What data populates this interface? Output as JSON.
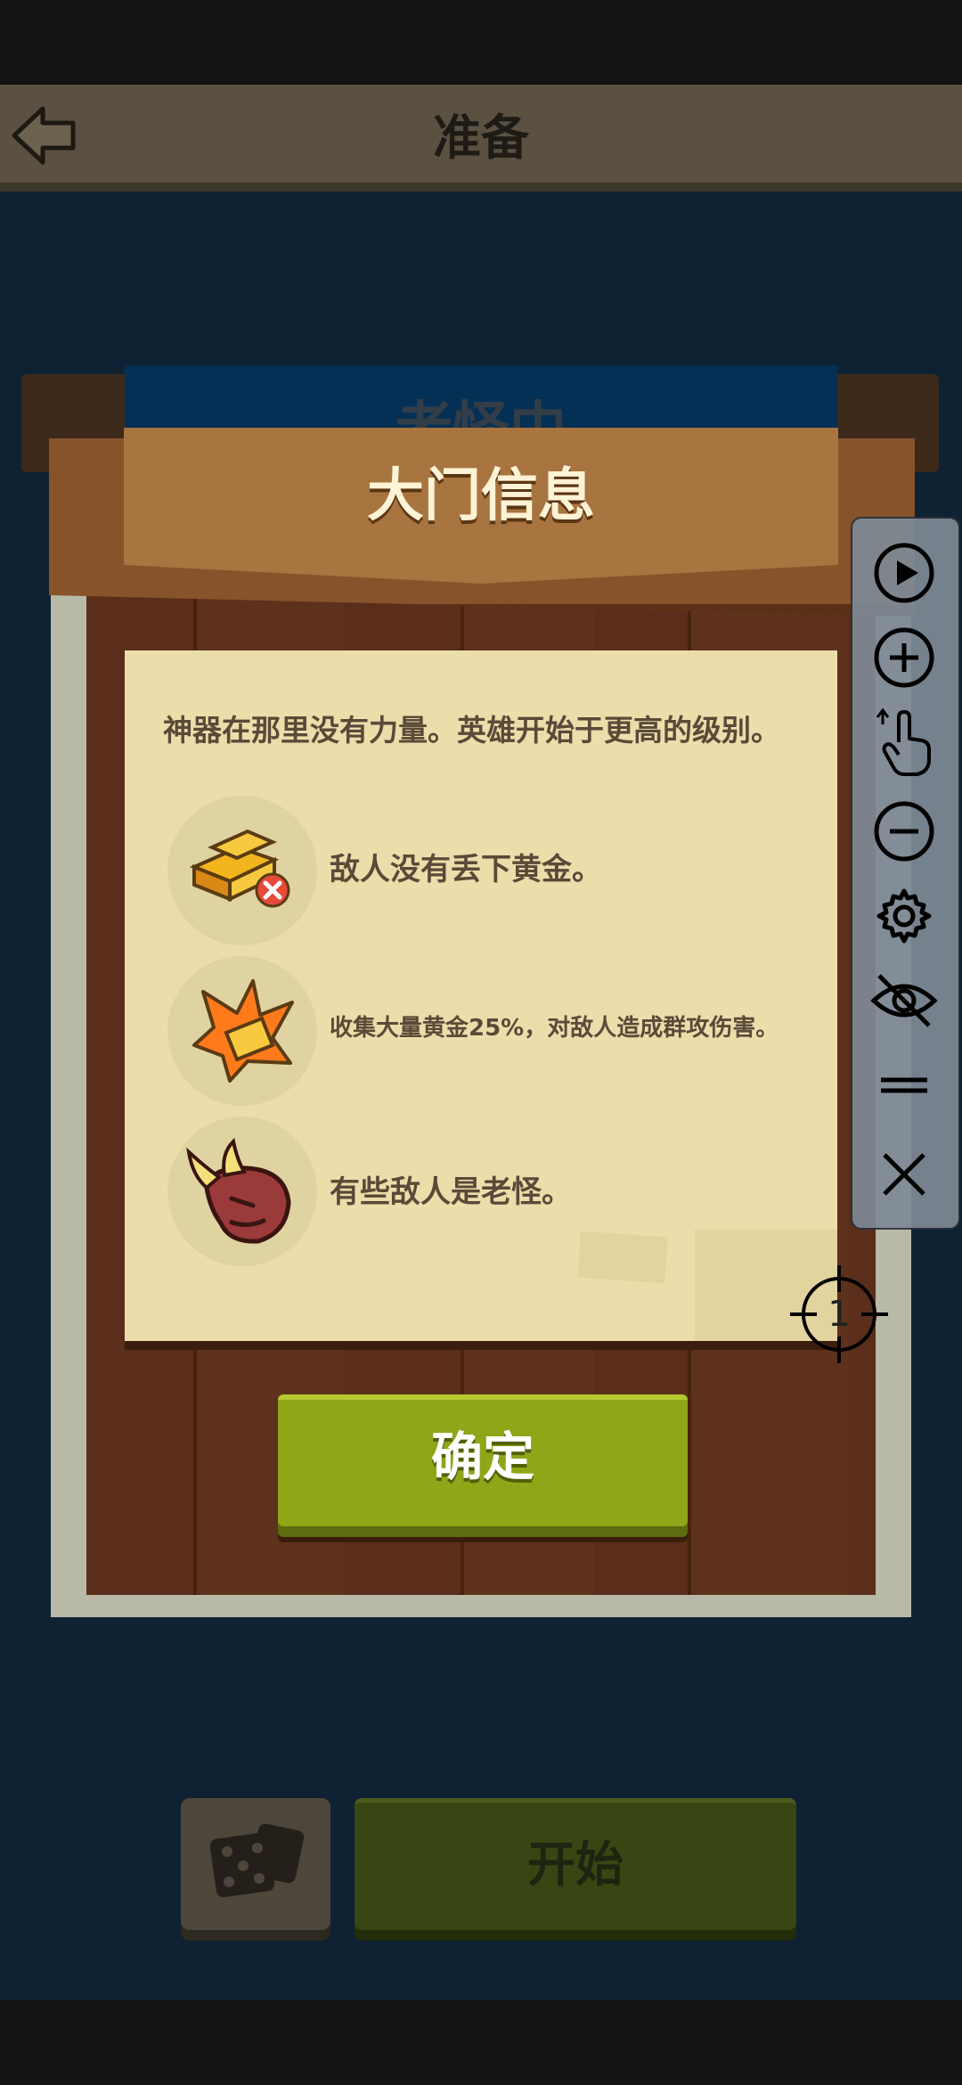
{
  "header": {
    "title": "准备"
  },
  "background": {
    "board_title": "老怪中"
  },
  "dialog": {
    "title": "大门信息",
    "intro": "神器在那里没有力量。英雄开始于更高的级别。",
    "features": [
      {
        "icon": "gold-bar-crossed-icon",
        "text": "敌人没有丢下黄金。"
      },
      {
        "icon": "gold-burst-icon",
        "text": "收集大量黄金25%，对敌人造成群攻伤害。"
      },
      {
        "icon": "horned-boss-icon",
        "text": "有些敌人是老怪。"
      }
    ],
    "confirm_label": "确定"
  },
  "toolbar": {
    "items": [
      "play-icon",
      "zoom-in-icon",
      "tap-gesture-icon",
      "zoom-out-icon",
      "settings-gear-icon",
      "hide-eye-icon",
      "menu-lines-icon",
      "close-icon"
    ]
  },
  "crosshair": {
    "label": "1"
  },
  "bottom": {
    "start_label": "开始"
  },
  "colors": {
    "confirm_green": "#8fa619",
    "parchment": "#ebdeab",
    "wood": "#5a2e1a",
    "banner": "#a8743f"
  }
}
